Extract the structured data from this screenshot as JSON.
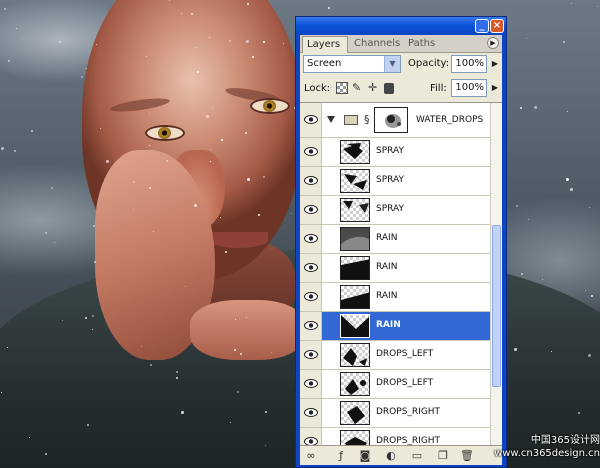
{
  "panel": {
    "tabs": [
      {
        "label": "Layers",
        "active": true
      },
      {
        "label": "Channels",
        "active": false
      },
      {
        "label": "Paths",
        "active": false
      }
    ],
    "blend_mode": "Screen",
    "opacity_label": "Opacity:",
    "opacity_value": "100%",
    "lock_label": "Lock:",
    "fill_label": "Fill:",
    "fill_value": "100%",
    "group": {
      "name": "WATER_DROPS",
      "expanded": true
    },
    "layers": [
      {
        "name": "SPRAY",
        "selected": false,
        "thumb": "spray-1"
      },
      {
        "name": "SPRAY",
        "selected": false,
        "thumb": "spray-2"
      },
      {
        "name": "SPRAY",
        "selected": false,
        "thumb": "spray-3"
      },
      {
        "name": "RAIN",
        "selected": false,
        "thumb": "rain-texture"
      },
      {
        "name": "RAIN",
        "selected": false,
        "thumb": "rain-wedge-1"
      },
      {
        "name": "RAIN",
        "selected": false,
        "thumb": "rain-wedge-2"
      },
      {
        "name": "RAIN",
        "selected": true,
        "thumb": "rain-wedge-3"
      },
      {
        "name": "DROPS_LEFT",
        "selected": false,
        "thumb": "drops-left-1"
      },
      {
        "name": "DROPS_LEFT",
        "selected": false,
        "thumb": "drops-left-2"
      },
      {
        "name": "DROPS_RIGHT",
        "selected": false,
        "thumb": "drops-right-1"
      },
      {
        "name": "DROPS_RIGHT",
        "selected": false,
        "thumb": "drops-right-2"
      }
    ]
  },
  "colors": {
    "titlebar": "#0a50d8",
    "selection": "#3168d5",
    "panel_bg": "#ece9d8"
  },
  "watermark": {
    "line1": "中国365设计网",
    "line2": "www.cn365design.cn"
  }
}
